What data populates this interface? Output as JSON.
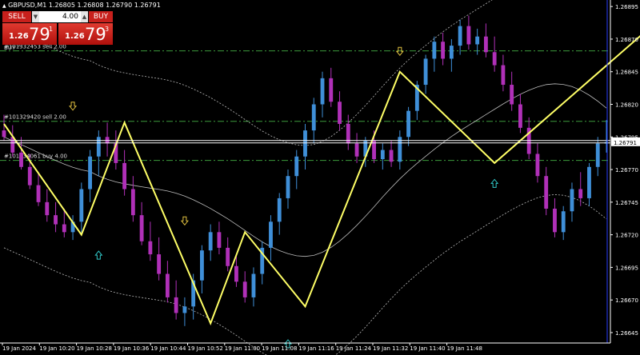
{
  "header": {
    "symbol_line": "GBPUSD,M1  1.26805 1.26808 1.26790 1.26791"
  },
  "trade_panel": {
    "sell_label": "SELL",
    "buy_label": "BUY",
    "lot": "4.00",
    "sell_price": {
      "small": "1.26",
      "big": "79",
      "sup": "1"
    },
    "buy_price": {
      "small": "1.26",
      "big": "79",
      "sup": "3"
    }
  },
  "chart_data": {
    "type": "candlestick",
    "symbol": "GBPUSD",
    "timeframe": "M1",
    "ohlc_header": {
      "open": 1.26805,
      "high": 1.26808,
      "low": 1.2679,
      "close": 1.26791
    },
    "y_ticks": [
      1.26895,
      1.2687,
      1.26845,
      1.2682,
      1.26795,
      1.2677,
      1.26745,
      1.2672,
      1.26695,
      1.2667,
      1.26645
    ],
    "ylim": [
      1.26637,
      1.269
    ],
    "x_ticks": [
      "19 Jan 2024",
      "19 Jan 10:20",
      "19 Jan 10:28",
      "19 Jan 10:36",
      "19 Jan 10:44",
      "19 Jan 10:52",
      "19 Jan 11:00",
      "19 Jan 11:08",
      "19 Jan 11:16",
      "19 Jan 11:24",
      "19 Jan 11:32",
      "19 Jan 11:40",
      "19 Jan 11:48"
    ],
    "current_price": 1.26791,
    "current_price_label": "1.26791",
    "colors": {
      "bull": "#3f8fd8",
      "bear": "#b030b8",
      "zigzag": "#ffff66",
      "order_line": "#3c9a3c",
      "arrow_down": "#e0c040",
      "arrow_up": "#30c8c8",
      "cursor_line": "#2a3cff"
    },
    "orders": [
      {
        "label": "#101332453 sell 2.00",
        "price": 1.26861
      },
      {
        "label": "#101329420 sell 2.00",
        "price": 1.26807
      },
      {
        "label": "#101334061 buy 4.00",
        "price": 1.26777
      }
    ],
    "line_label": "BUY ^",
    "zigzag": [
      [
        0,
        1.26805
      ],
      [
        9,
        1.2672
      ],
      [
        14,
        1.26806
      ],
      [
        24,
        1.26652
      ],
      [
        28,
        1.26722
      ],
      [
        35,
        1.26665
      ],
      [
        46,
        1.26845
      ],
      [
        57,
        1.26775
      ],
      [
        77,
        1.2689
      ],
      [
        88,
        1.26805
      ],
      [
        96,
        1.26723
      ],
      [
        103,
        1.26808
      ]
    ],
    "arrows_down": [
      [
        8,
        1.26818
      ],
      [
        21,
        1.2673
      ],
      [
        46,
        1.2686
      ],
      [
        77,
        1.26904
      ]
    ],
    "arrows_up": [
      [
        11,
        1.26705
      ],
      [
        33,
        1.26637
      ],
      [
        57,
        1.2676
      ],
      [
        93,
        1.26712
      ]
    ],
    "candles": [
      {
        "o": 1.268,
        "h": 1.26812,
        "l": 1.26792,
        "c": 1.26795
      },
      {
        "o": 1.26795,
        "h": 1.26804,
        "l": 1.2678,
        "c": 1.26783
      },
      {
        "o": 1.26783,
        "h": 1.26795,
        "l": 1.2677,
        "c": 1.26772
      },
      {
        "o": 1.26772,
        "h": 1.26782,
        "l": 1.26755,
        "c": 1.26758
      },
      {
        "o": 1.26758,
        "h": 1.26768,
        "l": 1.26742,
        "c": 1.26745
      },
      {
        "o": 1.26745,
        "h": 1.26755,
        "l": 1.2673,
        "c": 1.26735
      },
      {
        "o": 1.26735,
        "h": 1.26745,
        "l": 1.26722,
        "c": 1.26728
      },
      {
        "o": 1.26728,
        "h": 1.2674,
        "l": 1.26718,
        "c": 1.26722
      },
      {
        "o": 1.26722,
        "h": 1.26735,
        "l": 1.26716,
        "c": 1.2673
      },
      {
        "o": 1.2673,
        "h": 1.2676,
        "l": 1.2672,
        "c": 1.26755
      },
      {
        "o": 1.26755,
        "h": 1.26785,
        "l": 1.26745,
        "c": 1.2678
      },
      {
        "o": 1.2678,
        "h": 1.268,
        "l": 1.26765,
        "c": 1.26795
      },
      {
        "o": 1.26795,
        "h": 1.26806,
        "l": 1.2678,
        "c": 1.2679
      },
      {
        "o": 1.2679,
        "h": 1.268,
        "l": 1.2677,
        "c": 1.26775
      },
      {
        "o": 1.26775,
        "h": 1.26785,
        "l": 1.2675,
        "c": 1.26755
      },
      {
        "o": 1.26755,
        "h": 1.26765,
        "l": 1.2673,
        "c": 1.26735
      },
      {
        "o": 1.26735,
        "h": 1.26745,
        "l": 1.26712,
        "c": 1.26715
      },
      {
        "o": 1.26715,
        "h": 1.2673,
        "l": 1.267,
        "c": 1.26705
      },
      {
        "o": 1.26705,
        "h": 1.26718,
        "l": 1.26685,
        "c": 1.2669
      },
      {
        "o": 1.2669,
        "h": 1.267,
        "l": 1.26668,
        "c": 1.26672
      },
      {
        "o": 1.26672,
        "h": 1.26685,
        "l": 1.26655,
        "c": 1.2666
      },
      {
        "o": 1.2666,
        "h": 1.26672,
        "l": 1.2665,
        "c": 1.26665
      },
      {
        "o": 1.26665,
        "h": 1.2669,
        "l": 1.26655,
        "c": 1.26685
      },
      {
        "o": 1.26685,
        "h": 1.26712,
        "l": 1.26675,
        "c": 1.26708
      },
      {
        "o": 1.26708,
        "h": 1.26728,
        "l": 1.267,
        "c": 1.26722
      },
      {
        "o": 1.26722,
        "h": 1.2673,
        "l": 1.26705,
        "c": 1.2671
      },
      {
        "o": 1.2671,
        "h": 1.26718,
        "l": 1.26692,
        "c": 1.26696
      },
      {
        "o": 1.26696,
        "h": 1.26705,
        "l": 1.2668,
        "c": 1.26684
      },
      {
        "o": 1.26684,
        "h": 1.26692,
        "l": 1.26668,
        "c": 1.26672
      },
      {
        "o": 1.26672,
        "h": 1.26695,
        "l": 1.26665,
        "c": 1.2669
      },
      {
        "o": 1.2669,
        "h": 1.26715,
        "l": 1.26682,
        "c": 1.2671
      },
      {
        "o": 1.2671,
        "h": 1.26735,
        "l": 1.267,
        "c": 1.2673
      },
      {
        "o": 1.2673,
        "h": 1.26752,
        "l": 1.2672,
        "c": 1.26748
      },
      {
        "o": 1.26748,
        "h": 1.2677,
        "l": 1.2674,
        "c": 1.26765
      },
      {
        "o": 1.26765,
        "h": 1.26785,
        "l": 1.26755,
        "c": 1.2678
      },
      {
        "o": 1.2678,
        "h": 1.26805,
        "l": 1.2677,
        "c": 1.268
      },
      {
        "o": 1.268,
        "h": 1.26825,
        "l": 1.2679,
        "c": 1.2682
      },
      {
        "o": 1.2682,
        "h": 1.26845,
        "l": 1.2681,
        "c": 1.2684
      },
      {
        "o": 1.2684,
        "h": 1.26848,
        "l": 1.26818,
        "c": 1.26822
      },
      {
        "o": 1.26822,
        "h": 1.2683,
        "l": 1.268,
        "c": 1.26805
      },
      {
        "o": 1.26805,
        "h": 1.26812,
        "l": 1.26785,
        "c": 1.2679
      },
      {
        "o": 1.2679,
        "h": 1.26798,
        "l": 1.26775,
        "c": 1.2678
      },
      {
        "o": 1.2678,
        "h": 1.26795,
        "l": 1.26772,
        "c": 1.26792
      },
      {
        "o": 1.26792,
        "h": 1.268,
        "l": 1.26775,
        "c": 1.26778
      },
      {
        "o": 1.26778,
        "h": 1.2679,
        "l": 1.2677,
        "c": 1.26785
      },
      {
        "o": 1.26785,
        "h": 1.26792,
        "l": 1.26772,
        "c": 1.26776
      },
      {
        "o": 1.26776,
        "h": 1.268,
        "l": 1.2677,
        "c": 1.26795
      },
      {
        "o": 1.26795,
        "h": 1.26818,
        "l": 1.26788,
        "c": 1.26815
      },
      {
        "o": 1.26815,
        "h": 1.26838,
        "l": 1.26808,
        "c": 1.26835
      },
      {
        "o": 1.26835,
        "h": 1.26858,
        "l": 1.26828,
        "c": 1.26855
      },
      {
        "o": 1.26855,
        "h": 1.26872,
        "l": 1.26845,
        "c": 1.26868
      },
      {
        "o": 1.26868,
        "h": 1.26875,
        "l": 1.2685,
        "c": 1.26855
      },
      {
        "o": 1.26855,
        "h": 1.2687,
        "l": 1.26845,
        "c": 1.26865
      },
      {
        "o": 1.26865,
        "h": 1.26885,
        "l": 1.26858,
        "c": 1.2688
      },
      {
        "o": 1.2688,
        "h": 1.26888,
        "l": 1.26862,
        "c": 1.26866
      },
      {
        "o": 1.26866,
        "h": 1.26878,
        "l": 1.26858,
        "c": 1.26872
      },
      {
        "o": 1.26872,
        "h": 1.26882,
        "l": 1.26856,
        "c": 1.2686
      },
      {
        "o": 1.2686,
        "h": 1.26872,
        "l": 1.26845,
        "c": 1.2685
      },
      {
        "o": 1.2685,
        "h": 1.26858,
        "l": 1.2683,
        "c": 1.26835
      },
      {
        "o": 1.26835,
        "h": 1.26845,
        "l": 1.26815,
        "c": 1.2682
      },
      {
        "o": 1.2682,
        "h": 1.26828,
        "l": 1.26798,
        "c": 1.26802
      },
      {
        "o": 1.26802,
        "h": 1.2681,
        "l": 1.26778,
        "c": 1.26782
      },
      {
        "o": 1.26782,
        "h": 1.2679,
        "l": 1.2676,
        "c": 1.26765
      },
      {
        "o": 1.26765,
        "h": 1.26772,
        "l": 1.26735,
        "c": 1.2674
      },
      {
        "o": 1.2674,
        "h": 1.26748,
        "l": 1.26718,
        "c": 1.26722
      },
      {
        "o": 1.26722,
        "h": 1.26742,
        "l": 1.26716,
        "c": 1.26738
      },
      {
        "o": 1.26738,
        "h": 1.2676,
        "l": 1.2673,
        "c": 1.26755
      },
      {
        "o": 1.26755,
        "h": 1.26768,
        "l": 1.26742,
        "c": 1.26748
      },
      {
        "o": 1.26748,
        "h": 1.26775,
        "l": 1.26742,
        "c": 1.26772
      },
      {
        "o": 1.26772,
        "h": 1.26795,
        "l": 1.26765,
        "c": 1.2679
      },
      {
        "o": 1.2679,
        "h": 1.26808,
        "l": 1.26783,
        "c": 1.26791
      }
    ]
  }
}
